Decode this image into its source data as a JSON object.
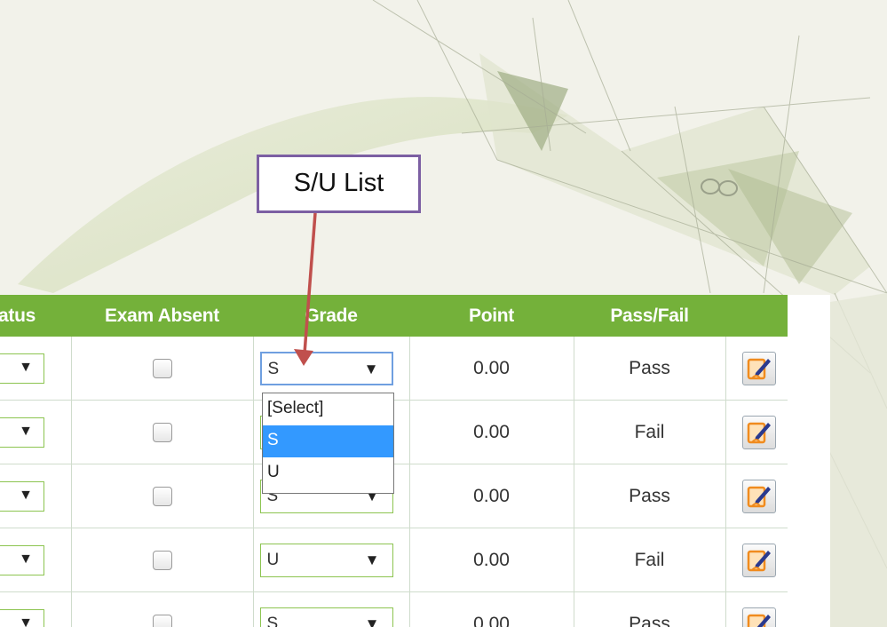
{
  "annotation": {
    "callout_text": "S/U List"
  },
  "table": {
    "headers": {
      "status": "atus",
      "exam_absent": "Exam Absent",
      "grade": "Grade",
      "point": "Point",
      "pass_fail": "Pass/Fail"
    },
    "rows": [
      {
        "status": "",
        "grade": "S",
        "point": "0.00",
        "pass_fail": "Pass"
      },
      {
        "status": "",
        "grade": "",
        "point": "0.00",
        "pass_fail": "Fail"
      },
      {
        "status": "",
        "grade": "S",
        "point": "0.00",
        "pass_fail": "Pass"
      },
      {
        "status": "",
        "grade": "U",
        "point": "0.00",
        "pass_fail": "Fail"
      },
      {
        "status": "",
        "grade": "S",
        "point": "0.00",
        "pass_fail": "Pass"
      }
    ]
  },
  "dropdown": {
    "options": [
      "[Select]",
      "S",
      "U"
    ],
    "selected": "S"
  },
  "colors": {
    "header_bg": "#74b13a",
    "select_border": "#8cc450",
    "dropdown_highlight": "#3399ff",
    "callout_border": "#7c5fa3",
    "arrow": "#c0504d"
  },
  "icons": {
    "status_arrow": "dropdown-arrow-icon",
    "grade_arrow": "dropdown-arrow-icon",
    "edit": "edit-pencil-icon"
  }
}
